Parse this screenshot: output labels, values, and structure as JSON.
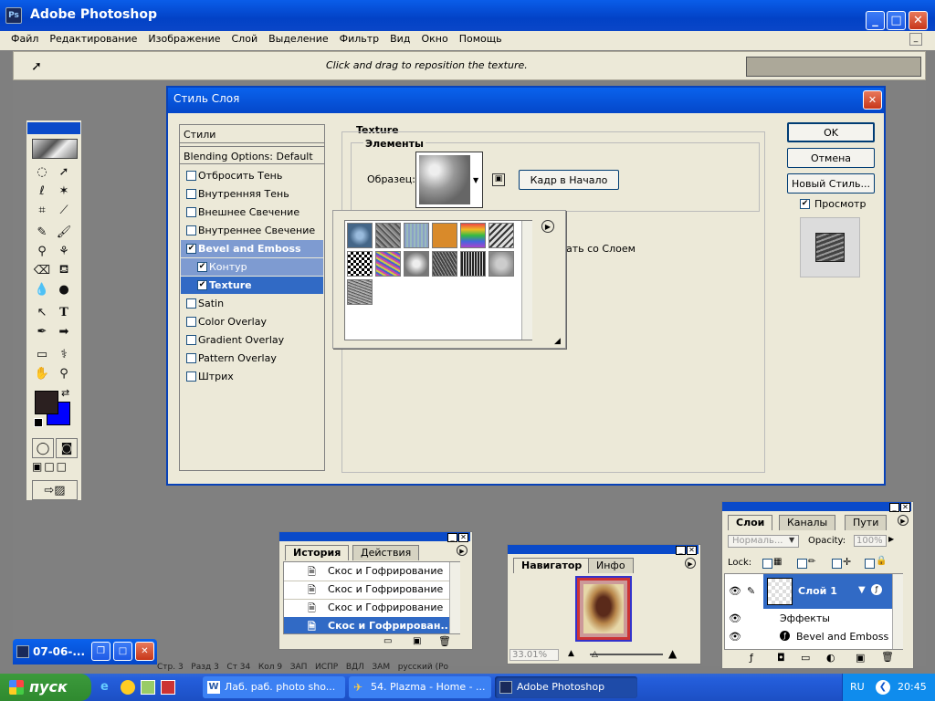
{
  "window": {
    "title": "Adobe Photoshop"
  },
  "menu": [
    "Файл",
    "Редактирование",
    "Изображение",
    "Слой",
    "Выделение",
    "Фильтр",
    "Вид",
    "Окно",
    "Помощь"
  ],
  "options_bar": {
    "hint": "Click and drag to reposition the texture."
  },
  "dialog": {
    "title": "Стиль Слоя",
    "styles_header": "Стили",
    "blending": "Blending Options: Default",
    "items": [
      {
        "label": "Отбросить Тень",
        "checked": false
      },
      {
        "label": "Внутренняя Тень",
        "checked": false
      },
      {
        "label": "Внешнее Свечение",
        "checked": false
      },
      {
        "label": "Внутреннее Свечение",
        "checked": false
      },
      {
        "label": "Bevel and Emboss",
        "checked": true
      },
      {
        "label": "Контур",
        "checked": true
      },
      {
        "label": "Texture",
        "checked": true
      },
      {
        "label": "Satin",
        "checked": false
      },
      {
        "label": "Color Overlay",
        "checked": false
      },
      {
        "label": "Gradient Overlay",
        "checked": false
      },
      {
        "label": "Pattern Overlay",
        "checked": false
      },
      {
        "label": "Штрих",
        "checked": false
      }
    ],
    "section_title": "Texture",
    "group_title": "Элементы",
    "pattern_label": "Образец:",
    "snap_button": "Кадр в Начало",
    "link_text": "ать со Слоем",
    "ok": "OK",
    "cancel": "Отмена",
    "new_style": "Новый Стиль...",
    "preview_label": "Просмотр",
    "preview_checked": true
  },
  "history": {
    "tabs": [
      "История",
      "Действия"
    ],
    "rows": [
      "Скос и Гофрирование",
      "Скос и Гофрирование",
      "Скос и Гофрирование",
      "Скос и Гофрирован..."
    ]
  },
  "navigator": {
    "tabs": [
      "Навигатор",
      "Инфо"
    ],
    "zoom": "33.01%"
  },
  "layers": {
    "tabs": [
      "Слои",
      "Каналы",
      "Пути"
    ],
    "blend_mode": "Нормаль...",
    "opacity_label": "Opacity:",
    "opacity_value": "100%",
    "lock_label": "Lock:",
    "layer_name": "Слой 1",
    "effects_label": "Эффекты",
    "effect_item": "Bevel and Emboss"
  },
  "minimized_window": {
    "title": "07-06-..."
  },
  "status_fragments": [
    "Стр. 3",
    "Разд 3",
    "Ст 34",
    "Кол 9",
    "ЗАП",
    "ИСПР",
    "ВДЛ",
    "ЗАМ",
    "русский (Ро"
  ],
  "taskbar": {
    "start": "пуск",
    "tasks": [
      "Лаб. раб. photo sho...",
      "54. Plazma - Home - ...",
      "Adobe Photoshop"
    ],
    "lang": "RU",
    "clock": "20:45"
  },
  "colors": {
    "title_blue": "#0a5de9",
    "selection": "#316ac5",
    "panel": "#ece9d8",
    "foreground": "#2b2020",
    "background": "#0000ff"
  }
}
